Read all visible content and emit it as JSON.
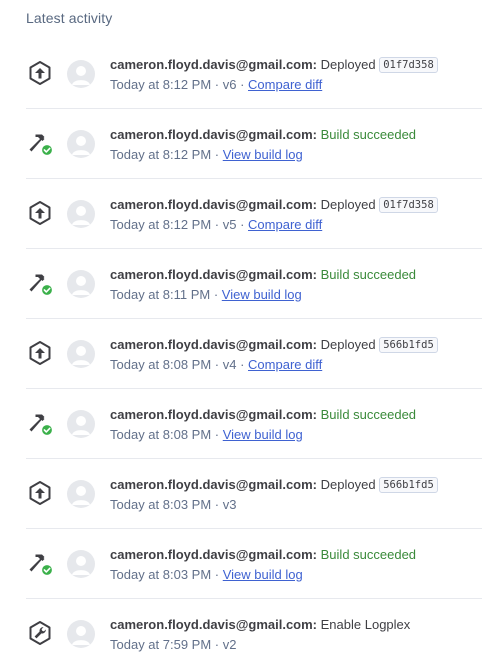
{
  "heading": "Latest activity",
  "activities": [
    {
      "icon": "deploy-icon",
      "email": "cameron.floyd.davis@gmail.com:",
      "message": "Deployed",
      "status": "neutral",
      "hash": "01f7d358",
      "time": "Today at 8:12 PM",
      "version": "v6",
      "link": "Compare diff"
    },
    {
      "icon": "build-success-icon",
      "email": "cameron.floyd.davis@gmail.com:",
      "message": "Build succeeded",
      "status": "success",
      "hash": "",
      "time": "Today at 8:12 PM",
      "version": "",
      "link": "View build log"
    },
    {
      "icon": "deploy-icon",
      "email": "cameron.floyd.davis@gmail.com:",
      "message": "Deployed",
      "status": "neutral",
      "hash": "01f7d358",
      "time": "Today at 8:12 PM",
      "version": "v5",
      "link": "Compare diff"
    },
    {
      "icon": "build-success-icon",
      "email": "cameron.floyd.davis@gmail.com:",
      "message": "Build succeeded",
      "status": "success",
      "hash": "",
      "time": "Today at 8:11 PM",
      "version": "",
      "link": "View build log"
    },
    {
      "icon": "deploy-icon",
      "email": "cameron.floyd.davis@gmail.com:",
      "message": "Deployed",
      "status": "neutral",
      "hash": "566b1fd5",
      "time": "Today at 8:08 PM",
      "version": "v4",
      "link": "Compare diff"
    },
    {
      "icon": "build-success-icon",
      "email": "cameron.floyd.davis@gmail.com:",
      "message": "Build succeeded",
      "status": "success",
      "hash": "",
      "time": "Today at 8:08 PM",
      "version": "",
      "link": "View build log"
    },
    {
      "icon": "deploy-icon",
      "email": "cameron.floyd.davis@gmail.com:",
      "message": "Deployed",
      "status": "neutral",
      "hash": "566b1fd5",
      "time": "Today at 8:03 PM",
      "version": "v3",
      "link": ""
    },
    {
      "icon": "build-success-icon",
      "email": "cameron.floyd.davis@gmail.com:",
      "message": "Build succeeded",
      "status": "success",
      "hash": "",
      "time": "Today at 8:03 PM",
      "version": "",
      "link": "View build log"
    },
    {
      "icon": "wrench-icon",
      "email": "cameron.floyd.davis@gmail.com:",
      "message": "Enable Logplex",
      "status": "neutral",
      "hash": "",
      "time": "Today at 7:59 PM",
      "version": "v2",
      "link": ""
    }
  ],
  "separator": " · ",
  "colors": {
    "success": "#3a8a3a",
    "link": "#3f62d1",
    "icon": "#3f3f44",
    "badge": "#3ab04a"
  }
}
